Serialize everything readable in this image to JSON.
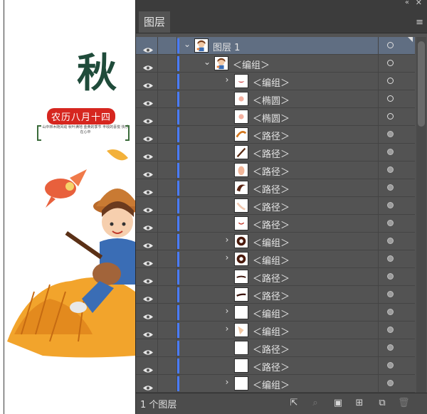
{
  "canvas": {
    "title": "秋",
    "date_badge": "农历八月十四",
    "body_text": "山中林木随风动 秋叶满地 金黄的季节 丰收的喜悦 快乐在心中"
  },
  "panel": {
    "tab_label": "图层",
    "collapse_icon": "double-chevron-left-icon",
    "close_icon": "close-icon",
    "menu_icon": "panel-menu-icon",
    "footer_label": "1 个图层",
    "footer_buttons": [
      {
        "name": "export-button",
        "glyph": "⇱"
      },
      {
        "name": "locate-object-button",
        "glyph": "⌕"
      },
      {
        "name": "clipping-mask-button",
        "glyph": "▣"
      },
      {
        "name": "new-sublayer-button",
        "glyph": "⊞"
      },
      {
        "name": "new-layer-button",
        "glyph": "⧉"
      },
      {
        "name": "delete-button",
        "glyph": "🗑"
      }
    ]
  },
  "layers": [
    {
      "label": "图层 1",
      "level": 0,
      "twisty": "⌄",
      "thumb": "girl",
      "selected": true,
      "target": "open"
    },
    {
      "label": "＜编组＞",
      "level": 1,
      "twisty": "⌄",
      "thumb": "girl",
      "target": "open"
    },
    {
      "label": "＜编组＞",
      "level": 2,
      "twisty": "›",
      "thumb": "lips",
      "target": "open"
    },
    {
      "label": "＜椭圆＞",
      "level": 2,
      "twisty": "",
      "thumb": "blush",
      "target": "open"
    },
    {
      "label": "＜椭圆＞",
      "level": 2,
      "twisty": "",
      "thumb": "blush",
      "target": "open"
    },
    {
      "label": "＜路径＞",
      "level": 2,
      "twisty": "",
      "thumb": "arc",
      "target": "filled"
    },
    {
      "label": "＜路径＞",
      "level": 2,
      "twisty": "",
      "thumb": "stroke",
      "target": "filled"
    },
    {
      "label": "＜路径＞",
      "level": 2,
      "twisty": "",
      "thumb": "hand",
      "target": "filled"
    },
    {
      "label": "＜路径＞",
      "level": 2,
      "twisty": "",
      "thumb": "hair",
      "target": "filled"
    },
    {
      "label": "＜路径＞",
      "level": 2,
      "twisty": "",
      "thumb": "faint",
      "target": "filled"
    },
    {
      "label": "＜路径＞",
      "level": 2,
      "twisty": "",
      "thumb": "mouth",
      "target": "filled"
    },
    {
      "label": "＜编组＞",
      "level": 2,
      "twisty": "›",
      "thumb": "hair2",
      "target": "filled"
    },
    {
      "label": "＜编组＞",
      "level": 2,
      "twisty": "›",
      "thumb": "hair2",
      "target": "filled"
    },
    {
      "label": "＜路径＞",
      "level": 2,
      "twisty": "",
      "thumb": "brow",
      "target": "filled"
    },
    {
      "label": "＜路径＞",
      "level": 2,
      "twisty": "",
      "thumb": "brow2",
      "target": "filled"
    },
    {
      "label": "＜编组＞",
      "level": 2,
      "twisty": "›",
      "thumb": "blank",
      "target": "filled"
    },
    {
      "label": "＜编组＞",
      "level": 2,
      "twisty": "›",
      "thumb": "skin",
      "target": "filled"
    },
    {
      "label": "＜路径＞",
      "level": 2,
      "twisty": "",
      "thumb": "blank",
      "target": "filled"
    },
    {
      "label": "＜路径＞",
      "level": 2,
      "twisty": "",
      "thumb": "blank",
      "target": "filled"
    },
    {
      "label": "＜编组＞",
      "level": 2,
      "twisty": "›",
      "thumb": "blank",
      "target": "filled"
    }
  ],
  "colors": {
    "panel_bg": "#535353",
    "selected_row": "#606e82",
    "layer_color": "#4a7cff",
    "accent_red": "#d6261f",
    "title_green": "#1f4b3a"
  }
}
